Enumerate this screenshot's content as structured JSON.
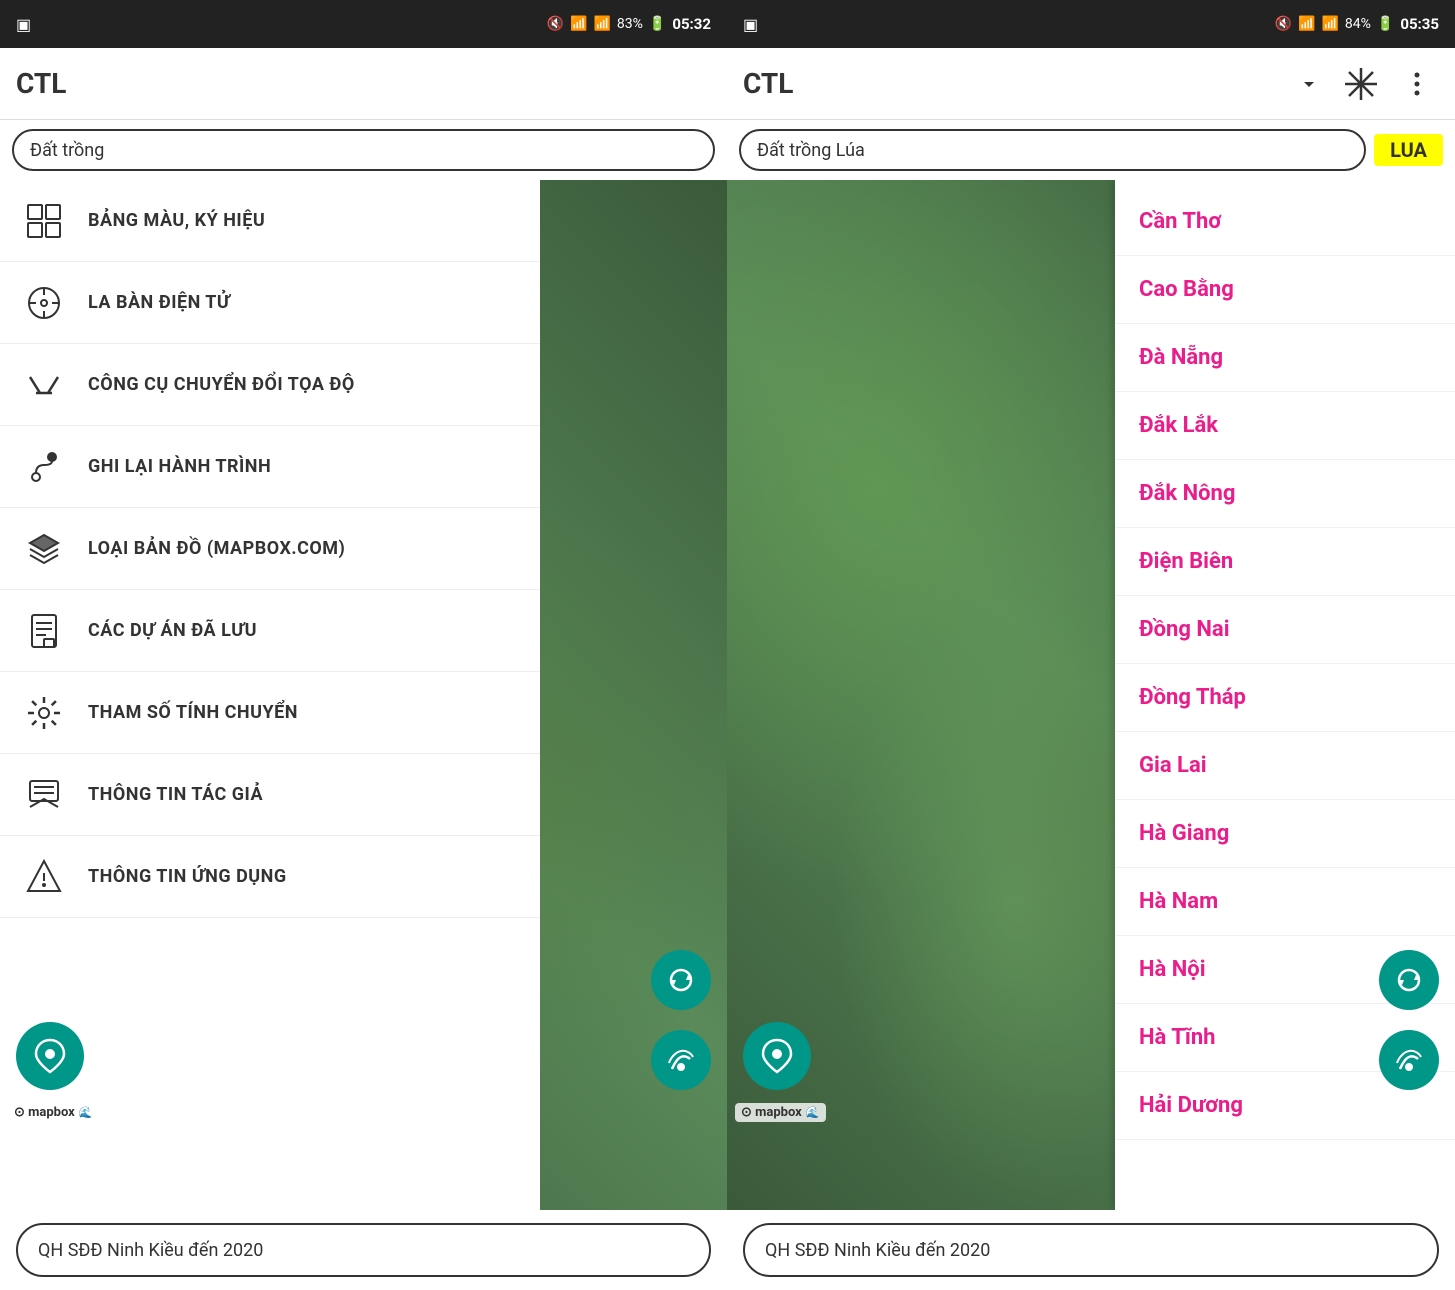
{
  "panel1": {
    "status_bar": {
      "battery": "83%",
      "time": "05:32"
    },
    "header": {
      "title": "CTL"
    },
    "search": {
      "placeholder": "Đất trồng"
    },
    "menu": {
      "items": [
        {
          "id": "bang-mau",
          "label": "BẢNG MÀU, KÝ HIỆU",
          "icon": "grid"
        },
        {
          "id": "la-ban",
          "label": "LA BÀN ĐIỆN TỬ",
          "icon": "compass"
        },
        {
          "id": "cong-cu",
          "label": "CÔNG CỤ CHUYỂN ĐỔI TỌA ĐỘ",
          "icon": "crosshair"
        },
        {
          "id": "ghi-lai",
          "label": "GHI LẠI HÀNH TRÌNH",
          "icon": "route"
        },
        {
          "id": "loai-ban-do",
          "label": "LOẠI BẢN ĐỒ (MAPBOX.COM)",
          "icon": "layers"
        },
        {
          "id": "cac-du-an",
          "label": "CÁC DỰ ÁN ĐÃ LƯU",
          "icon": "document"
        },
        {
          "id": "tham-so",
          "label": "THAM SỐ TÍNH CHUYỂN",
          "icon": "gear"
        },
        {
          "id": "thong-tin-tac-gia",
          "label": "THÔNG TIN TÁC GIẢ",
          "icon": "author"
        },
        {
          "id": "thong-tin-ung-dung",
          "label": "THÔNG TIN ỨNG DỤNG",
          "icon": "info"
        }
      ]
    },
    "bottom": {
      "text": "QH SĐĐ Ninh Kiều đến 2020"
    }
  },
  "panel2": {
    "status_bar": {
      "battery": "84%",
      "time": "05:35"
    },
    "header": {
      "title": "CTL",
      "selected_city": "Cần Thơ"
    },
    "search": {
      "text": "Đất trồng Lúa",
      "badge": "LUA"
    },
    "dropdown": {
      "items": [
        "Cần Thơ",
        "Cao Bằng",
        "Đà Nẵng",
        "Đắk Lắk",
        "Đắk Nông",
        "Điện Biên",
        "Đồng Nai",
        "Đồng Tháp",
        "Gia Lai",
        "Hà Giang",
        "Hà Nam",
        "Hà Nội",
        "Hà Tĩnh",
        "Hải Dương"
      ]
    },
    "bottom": {
      "text": "QH SĐĐ Ninh Kiều đến 2020"
    }
  }
}
